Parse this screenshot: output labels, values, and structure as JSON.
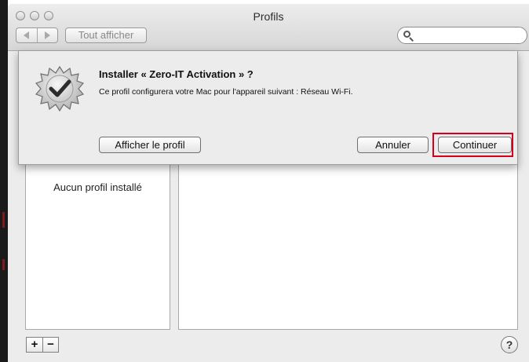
{
  "window": {
    "title": "Profils",
    "toolbar": {
      "back_icon": "chevron-left-icon",
      "forward_icon": "chevron-right-icon",
      "show_all_label": "Tout afficher",
      "search_placeholder": "",
      "search_icon": "search-icon"
    }
  },
  "sheet": {
    "icon": "verified-badge-icon",
    "title": "Installer « Zero-IT Activation » ?",
    "message": "Ce profil configurera votre Mac pour l'appareil suivant : Réseau Wi-Fi.",
    "buttons": {
      "show_profile": "Afficher le profil",
      "cancel": "Annuler",
      "continue": "Continuer"
    },
    "highlight_color": "#d6001c"
  },
  "profiles": {
    "empty_text": "Aucun profil installé"
  },
  "footer": {
    "add_label": "+",
    "remove_label": "−",
    "help_label": "?"
  }
}
